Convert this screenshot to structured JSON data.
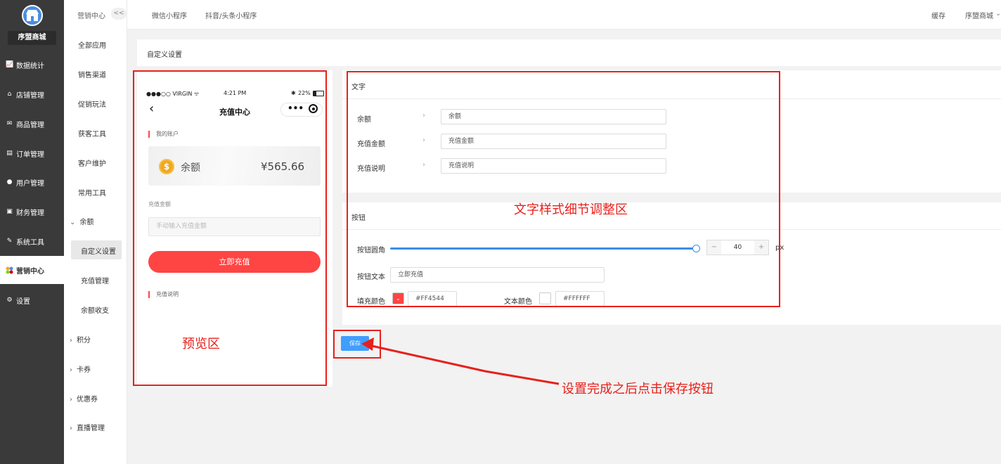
{
  "app": {
    "shop_name": "序盟商城"
  },
  "leftnav": {
    "items": [
      {
        "label": "数据统计",
        "icon": "chart-icon"
      },
      {
        "label": "店铺管理",
        "icon": "shop-icon"
      },
      {
        "label": "商品管理",
        "icon": "goods-icon"
      },
      {
        "label": "订单管理",
        "icon": "order-icon"
      },
      {
        "label": "用户管理",
        "icon": "user-icon"
      },
      {
        "label": "财务管理",
        "icon": "finance-icon"
      },
      {
        "label": "系统工具",
        "icon": "wrench-icon"
      },
      {
        "label": "营销中心",
        "icon": "marketing-icon"
      },
      {
        "label": "设置",
        "icon": "gear-icon"
      }
    ]
  },
  "subnav": {
    "title": "营销中心",
    "collapse": "<<",
    "items": [
      "全部应用",
      "销售渠道",
      "促销玩法",
      "获客工具",
      "客户维护",
      "常用工具"
    ],
    "balance_group": "余额",
    "balance_children": [
      "自定义设置",
      "充值管理",
      "余额收支"
    ],
    "more_groups": [
      "积分",
      "卡券",
      "优惠券",
      "直播管理"
    ]
  },
  "header": {
    "tabs": [
      "微信小程序",
      "抖音/头条小程序"
    ],
    "cache": "缓存",
    "shop": "序盟商城"
  },
  "page": {
    "title": "自定义设置"
  },
  "preview": {
    "status_left": "●●●○○ VIRGIN ᯤ",
    "status_time": "4:21 PM",
    "status_right": "22%",
    "nav_title": "充值中心",
    "my_account": "我的账户",
    "balance_label": "余额",
    "balance_value": "¥565.66",
    "amount_label": "充值金额",
    "amount_placeholder": "手动输入充值金额",
    "recharge_button": "立即充值",
    "desc_label": "充值说明"
  },
  "settings": {
    "text_section": "文字",
    "text_rows": [
      {
        "label": "余额",
        "value": "余额"
      },
      {
        "label": "充值金额",
        "value": "充值金额"
      },
      {
        "label": "充值说明",
        "value": "充值说明"
      }
    ],
    "button_section": "按钮",
    "radius_label": "按钮圆角",
    "radius_value": "40",
    "radius_unit": "px",
    "button_text_label": "按钮文本",
    "button_text_value": "立即充值",
    "fill_color_label": "填充颜色",
    "fill_color_value": "#FF4544",
    "text_color_label": "文本颜色",
    "text_color_value": "#FFFFFF"
  },
  "save_button": "保存",
  "annotations": {
    "preview": "预览区",
    "detail": "文字样式细节调整区",
    "save_hint": "设置完成之后点击保存按钮"
  },
  "colors": {
    "accent": "#409eff",
    "brand_red": "#ff4544",
    "annotation": "#e8201b"
  }
}
